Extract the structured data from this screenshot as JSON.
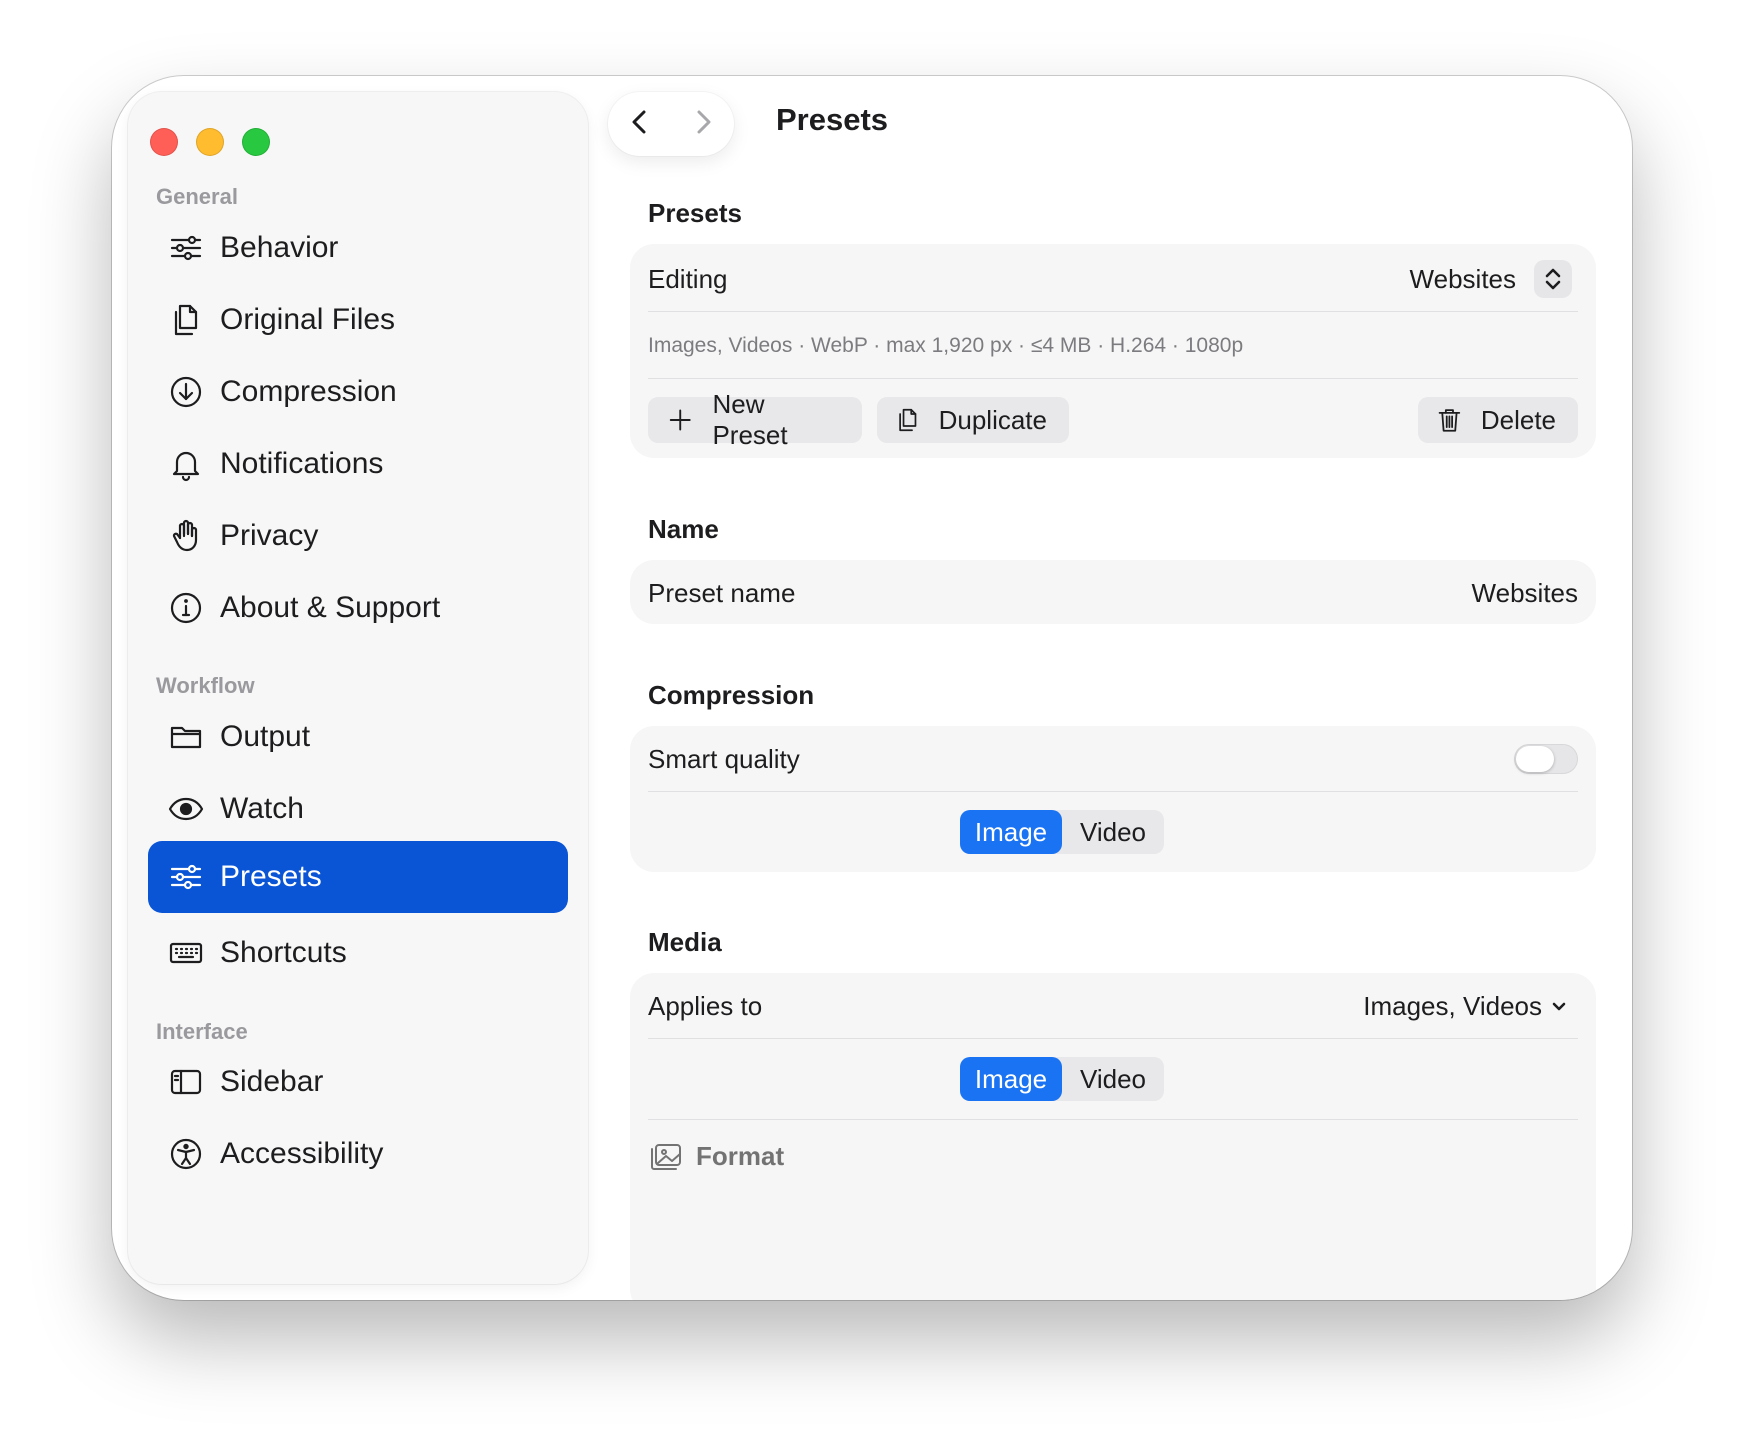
{
  "window": {
    "title": "Presets"
  },
  "sidebar": {
    "sections": [
      {
        "label": "General"
      },
      {
        "label": "Workflow"
      },
      {
        "label": "Interface"
      }
    ],
    "items": [
      {
        "label": "Behavior",
        "icon": "sliders-icon"
      },
      {
        "label": "Original Files",
        "icon": "documents-icon"
      },
      {
        "label": "Compression",
        "icon": "arrow-down-circle-icon"
      },
      {
        "label": "Notifications",
        "icon": "bell-icon"
      },
      {
        "label": "Privacy",
        "icon": "hand-raised-icon"
      },
      {
        "label": "About & Support",
        "icon": "info-circle-icon"
      },
      {
        "label": "Output",
        "icon": "folder-icon"
      },
      {
        "label": "Watch",
        "icon": "eye-icon"
      },
      {
        "label": "Presets",
        "icon": "sliders-icon",
        "selected": true
      },
      {
        "label": "Shortcuts",
        "icon": "keyboard-icon"
      },
      {
        "label": "Sidebar",
        "icon": "sidebar-icon"
      },
      {
        "label": "Accessibility",
        "icon": "accessibility-icon"
      }
    ]
  },
  "colors": {
    "accent": "#0a55d6",
    "segment_on": "#1a73f2"
  },
  "presets": {
    "group_title": "Presets",
    "editing_label": "Editing",
    "editing_value": "Websites",
    "summary": "Images, Videos · WebP · max 1,920 px · ≤4 MB · H.264 · 1080p",
    "new_preset": "New Preset",
    "duplicate": "Duplicate",
    "delete": "Delete"
  },
  "name": {
    "group_title": "Name",
    "label": "Preset name",
    "value": "Websites"
  },
  "compression": {
    "group_title": "Compression",
    "smart_quality_label": "Smart quality",
    "smart_quality_on": false,
    "segments": [
      "Image",
      "Video"
    ],
    "selected_segment": "Image"
  },
  "media": {
    "group_title": "Media",
    "applies_to_label": "Applies to",
    "applies_to_value": "Images, Videos",
    "segments": [
      "Image",
      "Video"
    ],
    "selected_segment": "Image",
    "format_label": "Format"
  }
}
